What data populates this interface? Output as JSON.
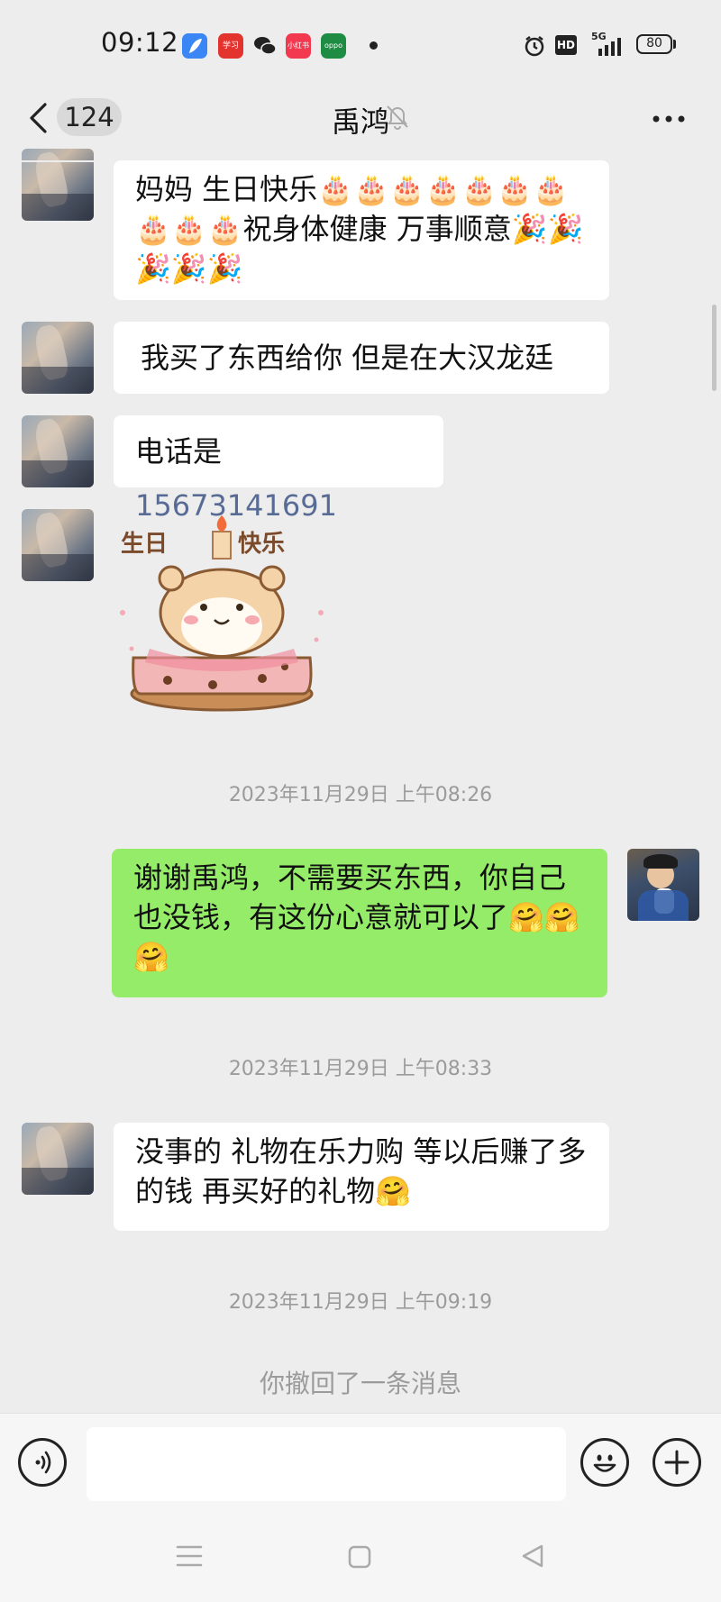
{
  "status_bar": {
    "time": "09:12",
    "app_icons": [
      {
        "name": "feather-app-icon",
        "color": "#3a86f5",
        "label": ""
      },
      {
        "name": "study-app-icon",
        "color": "#e3332f",
        "label": "学习"
      },
      {
        "name": "wechat-icon",
        "color": "#1a1a1a",
        "label": ""
      },
      {
        "name": "mi-app-icon",
        "color": "#f2394f",
        "label": "小红书"
      },
      {
        "name": "oppo-app-icon",
        "color": "#1f8c44",
        "label": "oppo"
      }
    ],
    "network": "5G",
    "hd": "HD",
    "battery": "80"
  },
  "header": {
    "unread_count": "124",
    "title": "禹鸿"
  },
  "messages": [
    {
      "sender": "other",
      "text": "妈妈 生日快乐🎂🎂🎂🎂🎂🎂🎂🎂🎂🎂祝身体健康 万事顺意🎉🎉🎉🎉🎉"
    },
    {
      "sender": "other",
      "text": "我买了东西给你 但是在大汉龙廷"
    },
    {
      "sender": "other",
      "prefix": "电话是 ",
      "phone": "15673141691"
    },
    {
      "sender": "other",
      "sticker_text_left": "生日",
      "sticker_text_right": "快乐"
    },
    {
      "timestamp": "2023年11月29日 上午08:26"
    },
    {
      "sender": "me",
      "text": "谢谢禹鸿，不需要买东西，你自己也没钱，有这份心意就可以了🤗🤗🤗"
    },
    {
      "timestamp": "2023年11月29日 上午08:33"
    },
    {
      "sender": "other",
      "text": "没事的 礼物在乐力购 等以后赚了多的钱 再买好的礼物🤗"
    },
    {
      "timestamp": "2023年11月29日 上午09:19"
    },
    {
      "system": "你撤回了一条消息"
    }
  ],
  "colors": {
    "background": "#ededed",
    "bubble_other": "#ffffff",
    "bubble_me": "#95ec69",
    "phone_link": "#576b95",
    "timestamp": "#9b9b9b"
  },
  "input_bar": {
    "voice_icon": "voice-icon",
    "emoji_icon": "emoji-icon",
    "plus_icon": "plus-icon",
    "input_value": ""
  }
}
